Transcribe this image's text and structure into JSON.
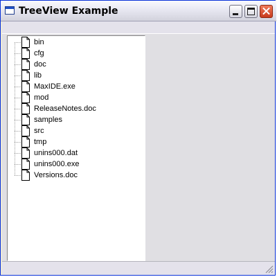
{
  "window": {
    "title": "TreeView Example",
    "icon": "window-app-icon",
    "controls": {
      "minimize_icon": "minimize-icon",
      "maximize_icon": "maximize-icon",
      "close_icon": "close-icon"
    }
  },
  "tree": {
    "item_icon": "document-icon",
    "items": [
      {
        "label": "bin"
      },
      {
        "label": "cfg"
      },
      {
        "label": "doc"
      },
      {
        "label": "lib"
      },
      {
        "label": "MaxIDE.exe"
      },
      {
        "label": "mod"
      },
      {
        "label": "ReleaseNotes.doc"
      },
      {
        "label": "samples"
      },
      {
        "label": "src"
      },
      {
        "label": "tmp"
      },
      {
        "label": "unins000.dat"
      },
      {
        "label": "unins000.exe"
      },
      {
        "label": "Versions.doc"
      }
    ]
  },
  "colors": {
    "title_bar": "#e6e6f0",
    "close_button": "#c73a1c",
    "client_background": "#e0dfe3",
    "tree_background": "#ffffff"
  }
}
